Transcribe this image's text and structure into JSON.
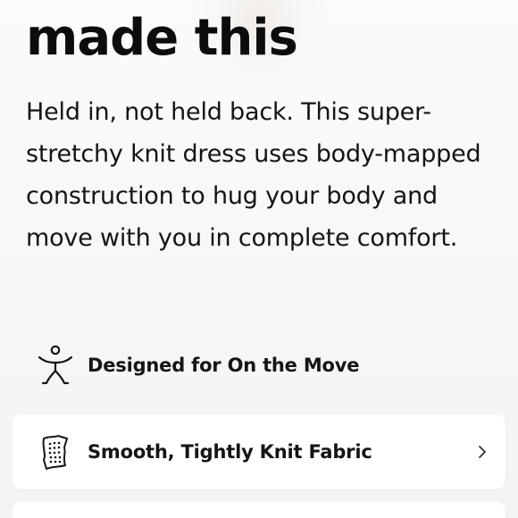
{
  "headline": "made this",
  "description": "Held in, not held back. This super-stretchy knit dress uses body-mapped construction to hug your body and move with you in complete comfort.",
  "features": {
    "on_the_move": {
      "label": "Designed for On the Move",
      "icon": "person-moving-icon"
    },
    "fabric": {
      "label": "Smooth, Tightly Knit Fabric",
      "icon": "fabric-swatch-icon",
      "action_icon": "chevron-right-icon"
    }
  },
  "colors": {
    "background": "#f5f5f5",
    "card": "#ffffff",
    "text": "#111111"
  }
}
